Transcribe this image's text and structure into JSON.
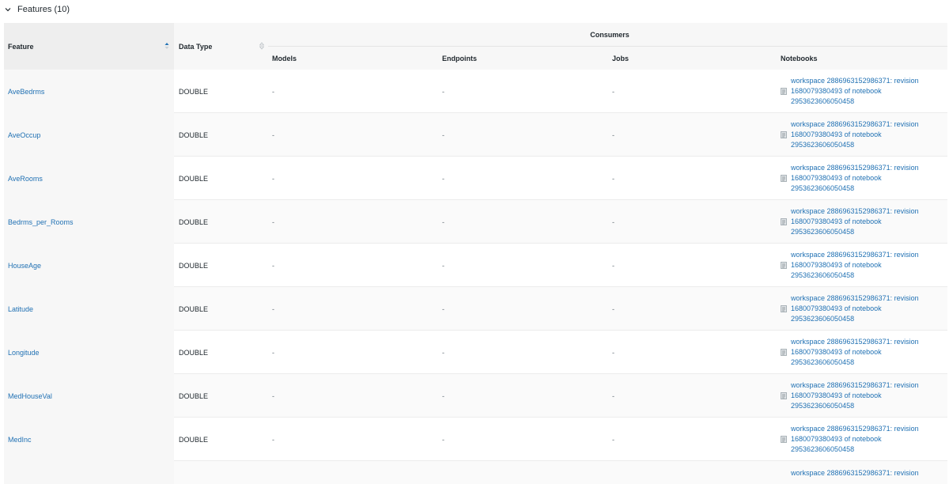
{
  "section": {
    "title": "Features (10)"
  },
  "table": {
    "headers": {
      "feature": "Feature",
      "data_type": "Data Type",
      "consumers": "Consumers",
      "models": "Models",
      "endpoints": "Endpoints",
      "jobs": "Jobs",
      "notebooks": "Notebooks"
    },
    "rows": [
      {
        "feature": "AveBedrms",
        "data_type": "DOUBLE",
        "models": "-",
        "endpoints": "-",
        "jobs": "-",
        "notebook": "workspace 2886963152986371: revision 1680079380493 of notebook 2953623606050458"
      },
      {
        "feature": "AveOccup",
        "data_type": "DOUBLE",
        "models": "-",
        "endpoints": "-",
        "jobs": "-",
        "notebook": "workspace 2886963152986371: revision 1680079380493 of notebook 2953623606050458"
      },
      {
        "feature": "AveRooms",
        "data_type": "DOUBLE",
        "models": "-",
        "endpoints": "-",
        "jobs": "-",
        "notebook": "workspace 2886963152986371: revision 1680079380493 of notebook 2953623606050458"
      },
      {
        "feature": "Bedrms_per_Rooms",
        "data_type": "DOUBLE",
        "models": "-",
        "endpoints": "-",
        "jobs": "-",
        "notebook": "workspace 2886963152986371: revision 1680079380493 of notebook 2953623606050458"
      },
      {
        "feature": "HouseAge",
        "data_type": "DOUBLE",
        "models": "-",
        "endpoints": "-",
        "jobs": "-",
        "notebook": "workspace 2886963152986371: revision 1680079380493 of notebook 2953623606050458"
      },
      {
        "feature": "Latitude",
        "data_type": "DOUBLE",
        "models": "-",
        "endpoints": "-",
        "jobs": "-",
        "notebook": "workspace 2886963152986371: revision 1680079380493 of notebook 2953623606050458"
      },
      {
        "feature": "Longitude",
        "data_type": "DOUBLE",
        "models": "-",
        "endpoints": "-",
        "jobs": "-",
        "notebook": "workspace 2886963152986371: revision 1680079380493 of notebook 2953623606050458"
      },
      {
        "feature": "MedHouseVal",
        "data_type": "DOUBLE",
        "models": "-",
        "endpoints": "-",
        "jobs": "-",
        "notebook": "workspace 2886963152986371: revision 1680079380493 of notebook 2953623606050458"
      },
      {
        "feature": "MedInc",
        "data_type": "DOUBLE",
        "models": "-",
        "endpoints": "-",
        "jobs": "-",
        "notebook": "workspace 2886963152986371: revision 1680079380493 of notebook 2953623606050458"
      },
      {
        "feature": "",
        "data_type": "",
        "models": "",
        "endpoints": "",
        "jobs": "",
        "notebook": "workspace 2886963152986371: revision"
      }
    ]
  },
  "colors": {
    "link": "#2272b4",
    "sort_active": "#2272b4",
    "sort_inactive": "#b9c0c5"
  },
  "icons": {
    "collapse": "chevron-down-icon",
    "sort_feature": "sort-ascending-icon",
    "sort_datatype": "sort-icon",
    "notebook": "notebook-icon"
  }
}
